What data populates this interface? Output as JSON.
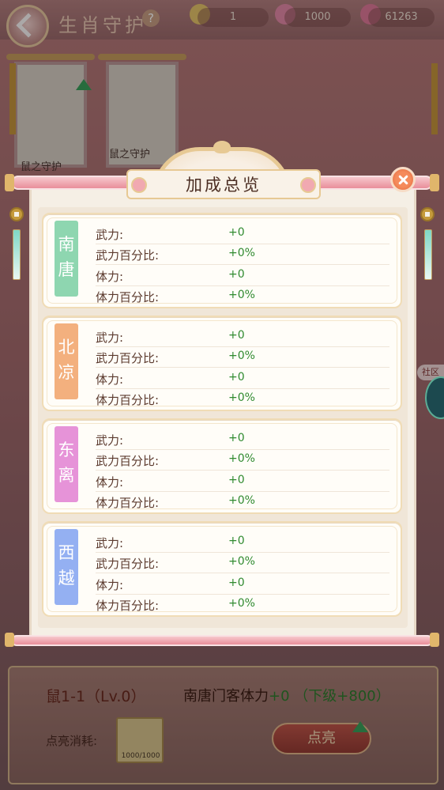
{
  "background": {
    "page_title": "生肖守护",
    "help_label": "?",
    "resources": [
      {
        "icon": "pen-icon",
        "value": "1"
      },
      {
        "icon": "lotus-icon",
        "value": "1000"
      },
      {
        "icon": "gem-icon",
        "value": "61263"
      }
    ],
    "cards": [
      {
        "label": "鼠之守护"
      },
      {
        "label": "鼠之守护"
      }
    ],
    "community_label": "社区",
    "zodiac_level": "鼠1-1（Lv.0）",
    "bonus_prefix": "南唐门客体力",
    "bonus_current": "+0",
    "bonus_next": "（下级+800）",
    "cost_label": "点亮消耗:",
    "lotus_count": "1000/1000",
    "light_button": "点亮"
  },
  "modal": {
    "title": "加成总览",
    "factions": [
      {
        "name": "南唐",
        "color": "#8ed6b0",
        "stats": [
          {
            "label": "武力:",
            "value": "+0"
          },
          {
            "label": "武力百分比:",
            "value": "+0%"
          },
          {
            "label": "体力:",
            "value": "+0"
          },
          {
            "label": "体力百分比:",
            "value": "+0%"
          }
        ]
      },
      {
        "name": "北凉",
        "color": "#f3b07e",
        "stats": [
          {
            "label": "武力:",
            "value": "+0"
          },
          {
            "label": "武力百分比:",
            "value": "+0%"
          },
          {
            "label": "体力:",
            "value": "+0"
          },
          {
            "label": "体力百分比:",
            "value": "+0%"
          }
        ]
      },
      {
        "name": "东离",
        "color": "#e693d8",
        "stats": [
          {
            "label": "武力:",
            "value": "+0"
          },
          {
            "label": "武力百分比:",
            "value": "+0%"
          },
          {
            "label": "体力:",
            "value": "+0"
          },
          {
            "label": "体力百分比:",
            "value": "+0%"
          }
        ]
      },
      {
        "name": "西越",
        "color": "#94b0f2",
        "stats": [
          {
            "label": "武力:",
            "value": "+0"
          },
          {
            "label": "武力百分比:",
            "value": "+0%"
          },
          {
            "label": "体力:",
            "value": "+0"
          },
          {
            "label": "体力百分比:",
            "value": "+0%"
          }
        ]
      }
    ]
  }
}
